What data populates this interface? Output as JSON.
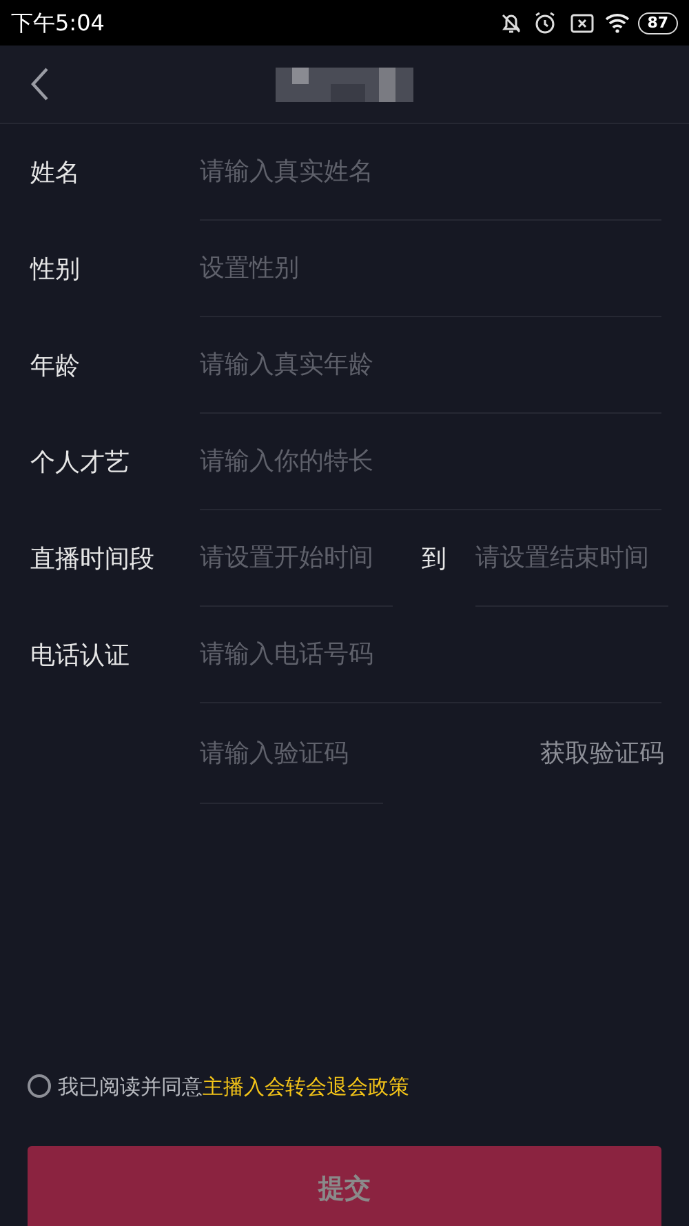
{
  "status_bar": {
    "time": "下午5:04",
    "battery": "87"
  },
  "form": {
    "rows": [
      {
        "kind": "text",
        "label": "姓名",
        "placeholder": "请输入真实姓名"
      },
      {
        "kind": "text",
        "label": "性别",
        "placeholder": "设置性别"
      },
      {
        "kind": "text",
        "label": "年龄",
        "placeholder": "请输入真实年龄"
      },
      {
        "kind": "text",
        "label": "个人才艺",
        "placeholder": "请输入你的特长"
      },
      {
        "kind": "range",
        "label": "直播时间段",
        "placeholder": "请设置开始时间",
        "separator": "到",
        "placeholder_end": "请设置结束时间"
      },
      {
        "kind": "text",
        "label": "电话认证",
        "placeholder": "请输入电话号码"
      },
      {
        "kind": "code",
        "placeholder": "请输入验证码",
        "action": "获取验证码"
      }
    ]
  },
  "agreement": {
    "checked": false,
    "text": "我已阅读并同意",
    "link": "主播入会转会退会政策"
  },
  "submit": {
    "label": "提交",
    "disabled": true
  }
}
